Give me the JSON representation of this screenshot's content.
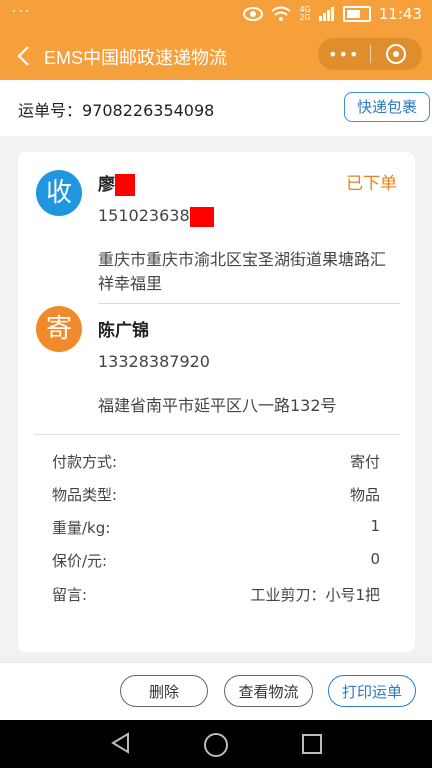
{
  "status_bar": {
    "left": "···",
    "time": "11:43",
    "net1": "4G",
    "net2": "2G"
  },
  "header": {
    "title": "EMS中国邮政速递物流",
    "more": "•••"
  },
  "waybill": {
    "label": "运单号：9708226354098",
    "tag": "快递包裹"
  },
  "receiver": {
    "avatar": "收",
    "name": "廖",
    "phone": "151023638",
    "address": "重庆市重庆市渝北区宝圣湖街道果塘路汇祥幸福里",
    "status": "已下单"
  },
  "sender": {
    "avatar": "寄",
    "name": "陈广锦",
    "phone": "13328387920",
    "address": "福建省南平市延平区八一路132号"
  },
  "details": [
    {
      "key": "付款方式:",
      "value": "寄付"
    },
    {
      "key": "物品类型:",
      "value": "物品"
    },
    {
      "key": "重量/kg:",
      "value": "1"
    },
    {
      "key": "保价/元:",
      "value": "0"
    },
    {
      "key": "留言:",
      "value": "工业剪刀：小号1把"
    }
  ],
  "actions": {
    "delete": "删除",
    "track": "查看物流",
    "print": "打印运单"
  },
  "colors": {
    "accent": "#f5a03a",
    "blue": "#2196e0",
    "status": "#f07e1c"
  }
}
